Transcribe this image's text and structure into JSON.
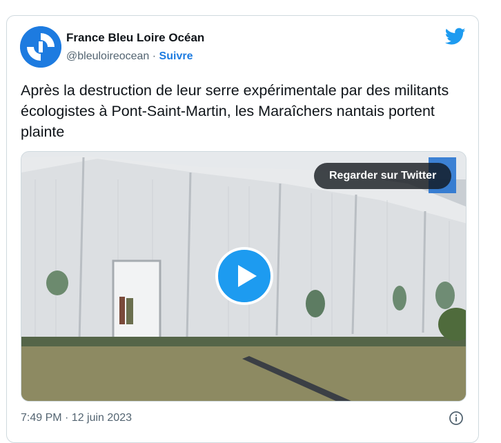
{
  "author": {
    "name": "France Bleu Loire Océan",
    "handle": "@bleuloireocean",
    "separator": " · ",
    "follow_label": "Suivre"
  },
  "tweet": {
    "text": "Après la destruction de leur serre expérimentale par des militants écologistes à Pont-Saint-Martin, les Maraîchers nantais portent plainte",
    "timestamp": "7:49 PM · 12 juin 2023"
  },
  "media": {
    "watch_label": "Regarder sur Twitter",
    "type": "video"
  },
  "icons": {
    "brand": "twitter-bird-icon",
    "play": "play-icon",
    "info": "info-icon",
    "avatar_logo": "france-bleu-logo"
  },
  "colors": {
    "accent": "#1d9bf0",
    "link": "#1d7be0",
    "text": "#0f1419",
    "muted": "#536471",
    "border": "#cfd9de"
  }
}
